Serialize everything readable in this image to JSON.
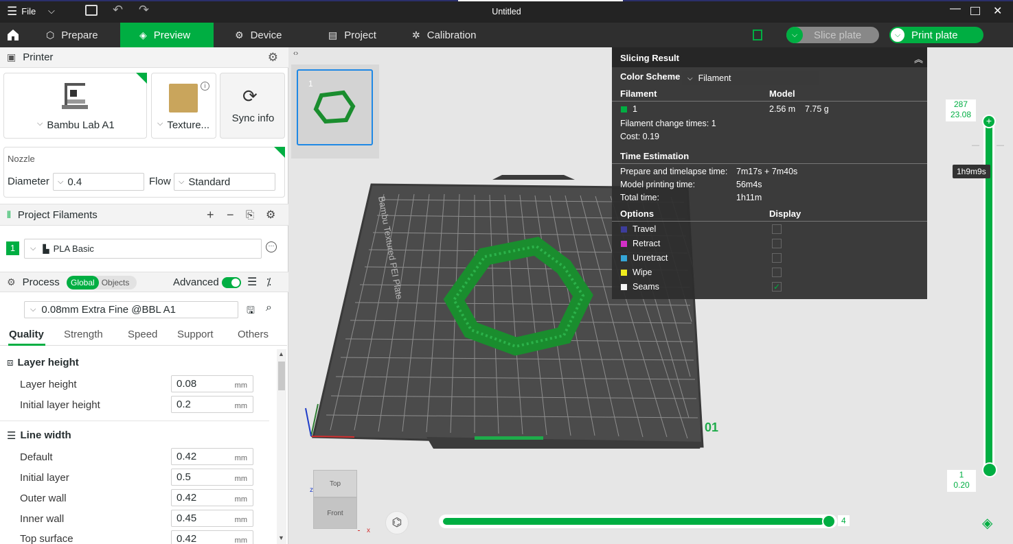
{
  "window": {
    "title": "Untitled",
    "file_menu": "File"
  },
  "tabs": [
    {
      "label": "Prepare"
    },
    {
      "label": "Preview"
    },
    {
      "label": "Device"
    },
    {
      "label": "Project"
    },
    {
      "label": "Calibration"
    }
  ],
  "toolbar": {
    "slice_label": "Slice plate",
    "print_label": "Print plate"
  },
  "printer": {
    "section_title": "Printer",
    "name": "Bambu Lab A1",
    "plate": "Texture...",
    "sync_label": "Sync info"
  },
  "nozzle": {
    "title": "Nozzle",
    "diameter_label": "Diameter",
    "diameter_value": "0.4",
    "flow_label": "Flow",
    "flow_value": "Standard"
  },
  "filaments": {
    "title": "Project Filaments",
    "items": [
      {
        "index": "1",
        "name": "PLA Basic"
      }
    ]
  },
  "process": {
    "title": "Process",
    "toggle_global": "Global",
    "toggle_objects": "Objects",
    "advanced_label": "Advanced",
    "preset": "0.08mm Extra Fine @BBL A1",
    "tabs": [
      "Quality",
      "Strength",
      "Speed",
      "Support",
      "Others"
    ],
    "groups": [
      {
        "title": "Layer height",
        "rows": [
          {
            "label": "Layer height",
            "value": "0.08",
            "unit": "mm"
          },
          {
            "label": "Initial layer height",
            "value": "0.2",
            "unit": "mm"
          }
        ]
      },
      {
        "title": "Line width",
        "rows": [
          {
            "label": "Default",
            "value": "0.42",
            "unit": "mm"
          },
          {
            "label": "Initial layer",
            "value": "0.5",
            "unit": "mm"
          },
          {
            "label": "Outer wall",
            "value": "0.42",
            "unit": "mm"
          },
          {
            "label": "Inner wall",
            "value": "0.45",
            "unit": "mm"
          },
          {
            "label": "Top surface",
            "value": "0.42",
            "unit": "mm"
          }
        ]
      }
    ]
  },
  "plate_thumb": {
    "number": "1"
  },
  "bed": {
    "brand_text": "Bambu Textured PEI Plate",
    "plate_number": "01"
  },
  "view_cube": {
    "top": "Top",
    "front": "Front",
    "axis_z": "z",
    "axis_x": "x"
  },
  "slicing_result": {
    "title": "Slicing Result",
    "color_scheme_label": "Color Scheme",
    "color_scheme_value": "Filament",
    "filament_header": "Filament",
    "model_header": "Model",
    "filament_row": {
      "index": "1",
      "length": "2.56 m",
      "weight": "7.75 g",
      "color": "#00ae42"
    },
    "change_times": "Filament change times:  1",
    "cost": "Cost:  0.19",
    "time_title": "Time Estimation",
    "times": [
      {
        "label": "Prepare and timelapse time:",
        "value": "7m17s + 7m40s"
      },
      {
        "label": "Model printing time:",
        "value": "56m4s"
      },
      {
        "label": "Total time:",
        "value": "1h11m"
      }
    ],
    "options_header": "Options",
    "display_header": "Display",
    "options": [
      {
        "label": "Travel",
        "color": "#3d3d9c",
        "checked": false
      },
      {
        "label": "Retract",
        "color": "#d330c7",
        "checked": false
      },
      {
        "label": "Unretract",
        "color": "#35a5d6",
        "checked": false
      },
      {
        "label": "Wipe",
        "color": "#f0ec1e",
        "checked": false
      },
      {
        "label": "Seams",
        "color": "#f5f5f5",
        "checked": true
      }
    ]
  },
  "layer_slider": {
    "top_layer": "287",
    "top_height": "23.08",
    "time_tip": "1h9m9s",
    "bottom_layer": "1",
    "bottom_height": "0.20"
  },
  "move_slider": {
    "value": "4"
  },
  "colors": {
    "accent": "#00ae42",
    "titlebar": "#232323",
    "tabbar": "#2f2f2f"
  }
}
